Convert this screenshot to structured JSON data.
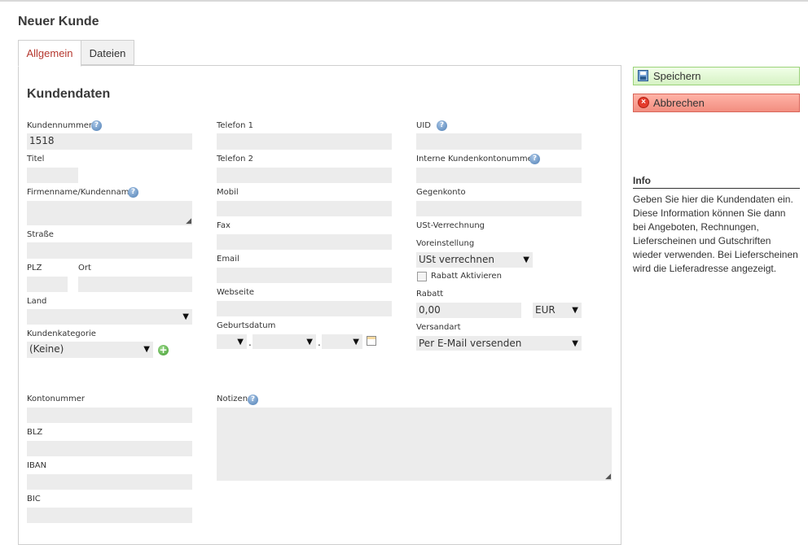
{
  "page": {
    "title": "Neuer Kunde"
  },
  "tabs": [
    {
      "label": "Allgemein",
      "active": true
    },
    {
      "label": "Dateien",
      "active": false
    }
  ],
  "section": {
    "title": "Kundendaten"
  },
  "form": {
    "kundennummer": {
      "label": "Kundennummer",
      "value": "1518"
    },
    "titel": {
      "label": "Titel",
      "value": ""
    },
    "firmenname": {
      "label": "Firmenname/Kundenname",
      "value": ""
    },
    "strasse": {
      "label": "Straße",
      "value": ""
    },
    "plz": {
      "label": "PLZ",
      "value": ""
    },
    "ort": {
      "label": "Ort",
      "value": ""
    },
    "land": {
      "label": "Land",
      "value": ""
    },
    "kundenkategorie": {
      "label": "Kundenkategorie",
      "value": "(Keine)"
    },
    "telefon1": {
      "label": "Telefon 1",
      "value": ""
    },
    "telefon2": {
      "label": "Telefon 2",
      "value": ""
    },
    "mobil": {
      "label": "Mobil",
      "value": ""
    },
    "fax": {
      "label": "Fax",
      "value": ""
    },
    "email": {
      "label": "Email",
      "value": ""
    },
    "webseite": {
      "label": "Webseite",
      "value": ""
    },
    "geburtsdatum": {
      "label": "Geburtsdatum",
      "separator1": ".",
      "separator2": "."
    },
    "uid": {
      "label": "UID",
      "value": ""
    },
    "interne_kontonummer": {
      "label": "Interne Kundenkontonummer",
      "value": ""
    },
    "gegenkonto": {
      "label": "Gegenkonto",
      "value": ""
    },
    "ust_verrechnung": {
      "label": "USt-Verrechnung"
    },
    "voreinstellung": {
      "label": "Voreinstellung",
      "value": "USt verrechnen"
    },
    "rabatt_aktivieren": {
      "label": "Rabatt Aktivieren",
      "checked": false
    },
    "rabatt": {
      "label": "Rabatt",
      "value": "0,00",
      "currency": "EUR"
    },
    "versandart": {
      "label": "Versandart",
      "value": "Per E-Mail versenden"
    },
    "kontonummer": {
      "label": "Kontonummer",
      "value": ""
    },
    "blz": {
      "label": "BLZ",
      "value": ""
    },
    "iban": {
      "label": "IBAN",
      "value": ""
    },
    "bic": {
      "label": "BIC",
      "value": ""
    },
    "notizen": {
      "label": "Notizen",
      "value": ""
    }
  },
  "actions": {
    "save_label": "Speichern",
    "cancel_label": "Abbrechen"
  },
  "info": {
    "title": "Info",
    "text": "Geben Sie hier die Kundendaten ein. Diese Information können Sie dann bei Angeboten, Rechnungen, Lieferscheinen und Gutschriften wieder verwenden. Bei Lieferscheinen wird die Lieferadresse angezeigt."
  },
  "icons": {
    "help": "help-icon",
    "add": "add-icon",
    "calendar": "calendar-icon",
    "save": "save-icon",
    "cancel": "cancel-icon"
  },
  "colors": {
    "active_tab_text": "#b5382f",
    "save_button_bg": "#d6f2c4",
    "cancel_button_bg": "#f28e80",
    "field_bg": "#ececec"
  }
}
